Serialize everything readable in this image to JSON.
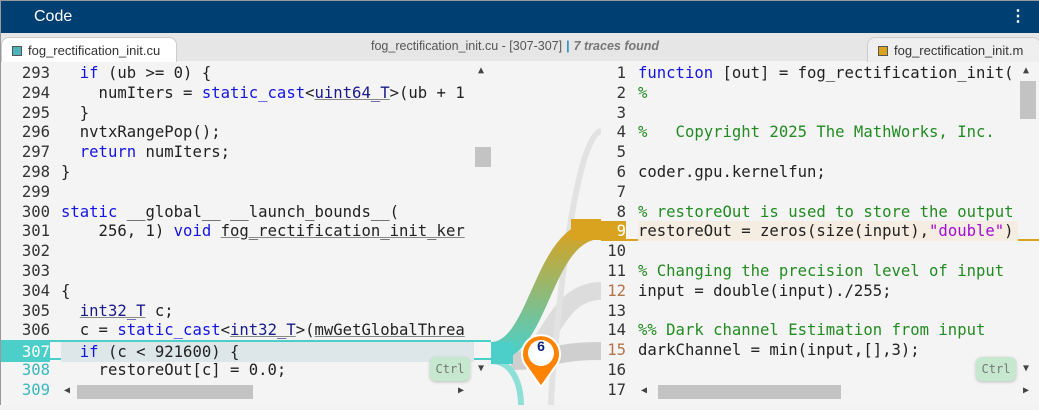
{
  "title": "Code",
  "menu_icon": "vertical-ellipsis-icon",
  "tabs": {
    "left": {
      "label": "fog_rectification_init.cu",
      "color": "#4cb3bd"
    },
    "right": {
      "label": "fog_rectification_init.m",
      "color": "#d9a21f"
    }
  },
  "trace_info": {
    "file": "fog_rectification_init.cu - [307-307]",
    "sep": "|",
    "count": "7 traces found"
  },
  "trace_count": "6",
  "colors": {
    "cuda_trace": "#4ccfc8",
    "matlab_trace": "#d9a21f",
    "marker": "#ff8200"
  },
  "ctrl_label": "Ctrl",
  "left_lines": [
    {
      "n": "293",
      "t": [
        [
          "  "
        ],
        [
          "if",
          "kw"
        ],
        [
          " (ub >= 0) {"
        ]
      ]
    },
    {
      "n": "294",
      "t": [
        [
          "    numIters = "
        ],
        [
          "static_cast",
          "kw"
        ],
        [
          "<"
        ],
        [
          "uint64_T",
          "ty"
        ],
        [
          ">(ub + 1"
        ]
      ]
    },
    {
      "n": "295",
      "t": [
        [
          "  }"
        ]
      ]
    },
    {
      "n": "296",
      "t": [
        [
          "  nvtxRangePop();"
        ]
      ]
    },
    {
      "n": "297",
      "t": [
        [
          "  "
        ],
        [
          "return",
          "kw"
        ],
        [
          " numIters;"
        ]
      ]
    },
    {
      "n": "298",
      "t": [
        [
          "}"
        ]
      ]
    },
    {
      "n": "299",
      "t": [
        [
          ""
        ]
      ]
    },
    {
      "n": "300",
      "t": [
        [
          "static",
          "kw"
        ],
        [
          " __global__ __launch_bounds__("
        ]
      ]
    },
    {
      "n": "301",
      "t": [
        [
          "    256, 1) "
        ],
        [
          "void",
          "kw"
        ],
        [
          " "
        ],
        [
          "fog_rectification_init_ker",
          "fn"
        ]
      ]
    },
    {
      "n": "302",
      "t": [
        [
          ""
        ]
      ]
    },
    {
      "n": "303",
      "t": [
        [
          ""
        ]
      ]
    },
    {
      "n": "304",
      "t": [
        [
          "{"
        ]
      ]
    },
    {
      "n": "305",
      "t": [
        [
          "  "
        ],
        [
          "int32_T",
          "ty"
        ],
        [
          " c;"
        ]
      ]
    },
    {
      "n": "306",
      "t": [
        [
          "  c = "
        ],
        [
          "static_cast",
          "kw"
        ],
        [
          "<"
        ],
        [
          "int32_T",
          "ty"
        ],
        [
          ">("
        ],
        [
          "mwGetGlobalThrea",
          "fn"
        ]
      ]
    },
    {
      "n": "307",
      "t": [
        [
          "  "
        ],
        [
          "if",
          "kw"
        ],
        [
          " (c < 921600) {"
        ]
      ],
      "cls": "hl-teal"
    },
    {
      "n": "308",
      "t": [
        [
          "    restoreOut[c] = 0.0;"
        ]
      ],
      "cls": "teal"
    },
    {
      "n": "309",
      "t": [
        [
          ""
        ]
      ],
      "cls": "teal"
    }
  ],
  "right_lines": [
    {
      "n": "1",
      "t": [
        [
          "function",
          "kw"
        ],
        [
          " [out] = fog_rectification_init("
        ]
      ]
    },
    {
      "n": "2",
      "t": [
        [
          "%",
          "cm"
        ]
      ]
    },
    {
      "n": "3",
      "t": [
        [
          ""
        ]
      ]
    },
    {
      "n": "4",
      "t": [
        [
          "%   Copyright 2025 The MathWorks, Inc.",
          "cm"
        ]
      ]
    },
    {
      "n": "5",
      "t": [
        [
          ""
        ]
      ]
    },
    {
      "n": "6",
      "t": [
        [
          "coder.gpu.kernelfun;"
        ]
      ]
    },
    {
      "n": "7",
      "t": [
        [
          ""
        ]
      ]
    },
    {
      "n": "8",
      "t": [
        [
          "% restoreOut is used to store the output",
          "cm"
        ]
      ]
    },
    {
      "n": "9",
      "t": [
        [
          "restoreOut = zeros(size(input),"
        ],
        [
          "\"double\"",
          "st"
        ],
        [
          ")"
        ]
      ],
      "cls": "hl-gold"
    },
    {
      "n": "10",
      "t": [
        [
          ""
        ]
      ]
    },
    {
      "n": "11",
      "t": [
        [
          "% Changing the precision level of input",
          "cm"
        ]
      ]
    },
    {
      "n": "12",
      "t": [
        [
          "input = double(input)./255;"
        ]
      ],
      "cls": "brown"
    },
    {
      "n": "13",
      "t": [
        [
          ""
        ]
      ]
    },
    {
      "n": "14",
      "t": [
        [
          "%% Dark channel Estimation from input",
          "cm"
        ]
      ]
    },
    {
      "n": "15",
      "t": [
        [
          "darkChannel = min(input,[],3);"
        ]
      ],
      "cls": "brown"
    },
    {
      "n": "16",
      "t": [
        [
          ""
        ]
      ]
    },
    {
      "n": "17",
      "t": [
        [
          ""
        ]
      ]
    }
  ]
}
